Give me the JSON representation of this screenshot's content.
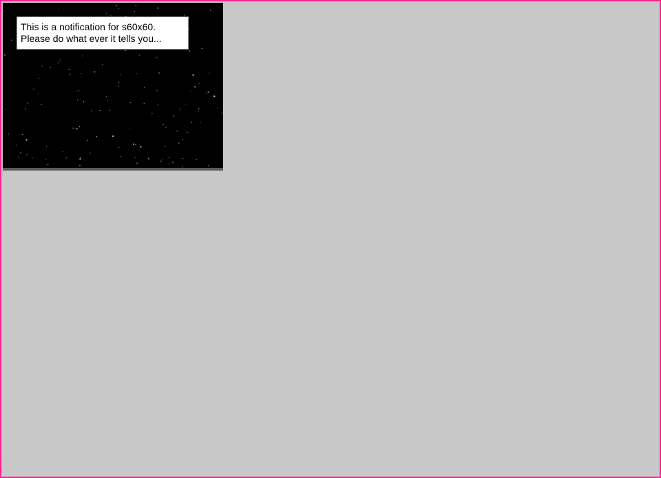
{
  "notification": {
    "line1": "This is a notification for s60x60.",
    "line2": "Please do what ever it tells you..."
  },
  "colors": {
    "frame_border": "#ff1f8e",
    "page_background": "#c8c8c8",
    "screen_background": "#000000",
    "notification_background": "#ffffff",
    "bottom_bar": "#5a5a5a"
  }
}
